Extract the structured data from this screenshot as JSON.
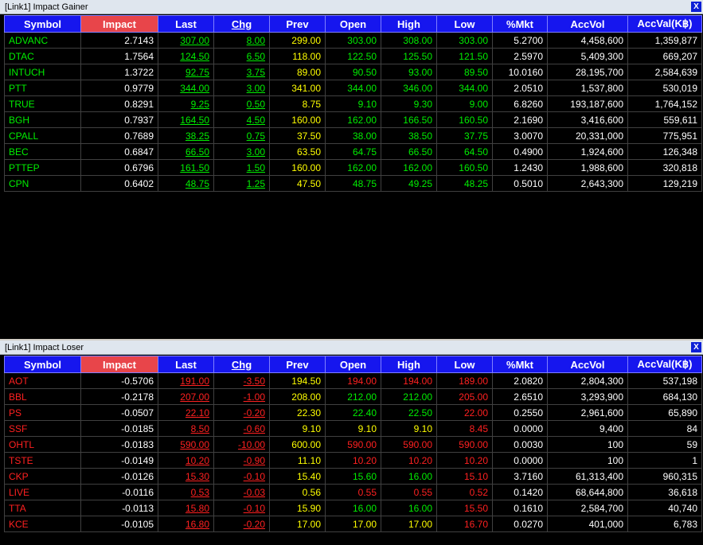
{
  "gainer": {
    "title": "[Link1] Impact Gainer",
    "close": "X",
    "headers": {
      "symbol": "Symbol",
      "impact": "Impact",
      "last": "Last",
      "chg": "Chg",
      "prev": "Prev",
      "open": "Open",
      "high": "High",
      "low": "Low",
      "mkt": "%Mkt",
      "accvol": "AccVol",
      "accval": "AccVal(K฿)"
    },
    "rows": [
      {
        "symbol": "ADVANC",
        "impact": "2.7143",
        "last": "307.00",
        "chg": "8.00",
        "prev": "299.00",
        "open": "303.00",
        "high": "308.00",
        "low": "303.00",
        "mkt": "5.2700",
        "accvol": "4,458,600",
        "accval": "1,359,877"
      },
      {
        "symbol": "DTAC",
        "impact": "1.7564",
        "last": "124.50",
        "chg": "6.50",
        "prev": "118.00",
        "open": "122.50",
        "high": "125.50",
        "low": "121.50",
        "mkt": "2.5970",
        "accvol": "5,409,300",
        "accval": "669,207"
      },
      {
        "symbol": "INTUCH",
        "impact": "1.3722",
        "last": "92.75",
        "chg": "3.75",
        "prev": "89.00",
        "open": "90.50",
        "high": "93.00",
        "low": "89.50",
        "mkt": "10.0160",
        "accvol": "28,195,700",
        "accval": "2,584,639"
      },
      {
        "symbol": "PTT",
        "impact": "0.9779",
        "last": "344.00",
        "chg": "3.00",
        "prev": "341.00",
        "open": "344.00",
        "high": "346.00",
        "low": "344.00",
        "mkt": "2.0510",
        "accvol": "1,537,800",
        "accval": "530,019"
      },
      {
        "symbol": "TRUE",
        "impact": "0.8291",
        "last": "9.25",
        "chg": "0.50",
        "prev": "8.75",
        "open": "9.10",
        "high": "9.30",
        "low": "9.00",
        "mkt": "6.8260",
        "accvol": "193,187,600",
        "accval": "1,764,152"
      },
      {
        "symbol": "BGH",
        "impact": "0.7937",
        "last": "164.50",
        "chg": "4.50",
        "prev": "160.00",
        "open": "162.00",
        "high": "166.50",
        "low": "160.50",
        "mkt": "2.1690",
        "accvol": "3,416,600",
        "accval": "559,611"
      },
      {
        "symbol": "CPALL",
        "impact": "0.7689",
        "last": "38.25",
        "chg": "0.75",
        "prev": "37.50",
        "open": "38.00",
        "high": "38.50",
        "low": "37.75",
        "mkt": "3.0070",
        "accvol": "20,331,000",
        "accval": "775,951"
      },
      {
        "symbol": "BEC",
        "impact": "0.6847",
        "last": "66.50",
        "chg": "3.00",
        "prev": "63.50",
        "open": "64.75",
        "high": "66.50",
        "low": "64.50",
        "mkt": "0.4900",
        "accvol": "1,924,600",
        "accval": "126,348"
      },
      {
        "symbol": "PTTEP",
        "impact": "0.6796",
        "last": "161.50",
        "chg": "1.50",
        "prev": "160.00",
        "open": "162.00",
        "high": "162.00",
        "low": "160.50",
        "mkt": "1.2430",
        "accvol": "1,988,600",
        "accval": "320,818"
      },
      {
        "symbol": "CPN",
        "impact": "0.6402",
        "last": "48.75",
        "chg": "1.25",
        "prev": "47.50",
        "open": "48.75",
        "high": "49.25",
        "low": "48.25",
        "mkt": "0.5010",
        "accvol": "2,643,300",
        "accval": "129,219"
      }
    ]
  },
  "loser": {
    "title": "[Link1] Impact Loser",
    "close": "X",
    "headers": {
      "symbol": "Symbol",
      "impact": "Impact",
      "last": "Last",
      "chg": "Chg",
      "prev": "Prev",
      "open": "Open",
      "high": "High",
      "low": "Low",
      "mkt": "%Mkt",
      "accvol": "AccVol",
      "accval": "AccVal(K฿)"
    },
    "rows": [
      {
        "symbol": "AOT",
        "impact": "-0.5706",
        "last": "191.00",
        "chg": "-3.50",
        "prev": "194.50",
        "open": "194.00",
        "high": "194.00",
        "low": "189.00",
        "mkt": "2.0820",
        "accvol": "2,804,300",
        "accval": "537,198"
      },
      {
        "symbol": "BBL",
        "impact": "-0.2178",
        "last": "207.00",
        "chg": "-1.00",
        "prev": "208.00",
        "open": "212.00",
        "high": "212.00",
        "low": "205.00",
        "mkt": "2.6510",
        "accvol": "3,293,900",
        "accval": "684,130"
      },
      {
        "symbol": "PS",
        "impact": "-0.0507",
        "last": "22.10",
        "chg": "-0.20",
        "prev": "22.30",
        "open": "22.40",
        "high": "22.50",
        "low": "22.00",
        "mkt": "0.2550",
        "accvol": "2,961,600",
        "accval": "65,890"
      },
      {
        "symbol": "SSF",
        "impact": "-0.0185",
        "last": "8.50",
        "chg": "-0.60",
        "prev": "9.10",
        "open": "9.10",
        "high": "9.10",
        "low": "8.45",
        "mkt": "0.0000",
        "accvol": "9,400",
        "accval": "84"
      },
      {
        "symbol": "OHTL",
        "impact": "-0.0183",
        "last": "590.00",
        "chg": "-10.00",
        "prev": "600.00",
        "open": "590.00",
        "high": "590.00",
        "low": "590.00",
        "mkt": "0.0030",
        "accvol": "100",
        "accval": "59"
      },
      {
        "symbol": "TSTE",
        "impact": "-0.0149",
        "last": "10.20",
        "chg": "-0.90",
        "prev": "11.10",
        "open": "10.20",
        "high": "10.20",
        "low": "10.20",
        "mkt": "0.0000",
        "accvol": "100",
        "accval": "1"
      },
      {
        "symbol": "CKP",
        "impact": "-0.0126",
        "last": "15.30",
        "chg": "-0.10",
        "prev": "15.40",
        "open": "15.60",
        "high": "16.00",
        "low": "15.10",
        "mkt": "3.7160",
        "accvol": "61,313,400",
        "accval": "960,315"
      },
      {
        "symbol": "LIVE",
        "impact": "-0.0116",
        "last": "0.53",
        "chg": "-0.03",
        "prev": "0.56",
        "open": "0.55",
        "high": "0.55",
        "low": "0.52",
        "mkt": "0.1420",
        "accvol": "68,644,800",
        "accval": "36,618"
      },
      {
        "symbol": "TTA",
        "impact": "-0.0113",
        "last": "15.80",
        "chg": "-0.10",
        "prev": "15.90",
        "open": "16.00",
        "high": "16.00",
        "low": "15.50",
        "mkt": "0.1610",
        "accvol": "2,584,700",
        "accval": "40,740"
      },
      {
        "symbol": "KCE",
        "impact": "-0.0105",
        "last": "16.80",
        "chg": "-0.20",
        "prev": "17.00",
        "open": "17.00",
        "high": "17.00",
        "low": "16.70",
        "mkt": "0.0270",
        "accvol": "401,000",
        "accval": "6,783"
      }
    ]
  },
  "colors": {
    "header_bg": "#1616ee",
    "impact_header_bg": "#e8454a",
    "up": "#00ee00",
    "down": "#ff2020",
    "unchanged": "#ffff00",
    "neutral": "#ffffff"
  }
}
